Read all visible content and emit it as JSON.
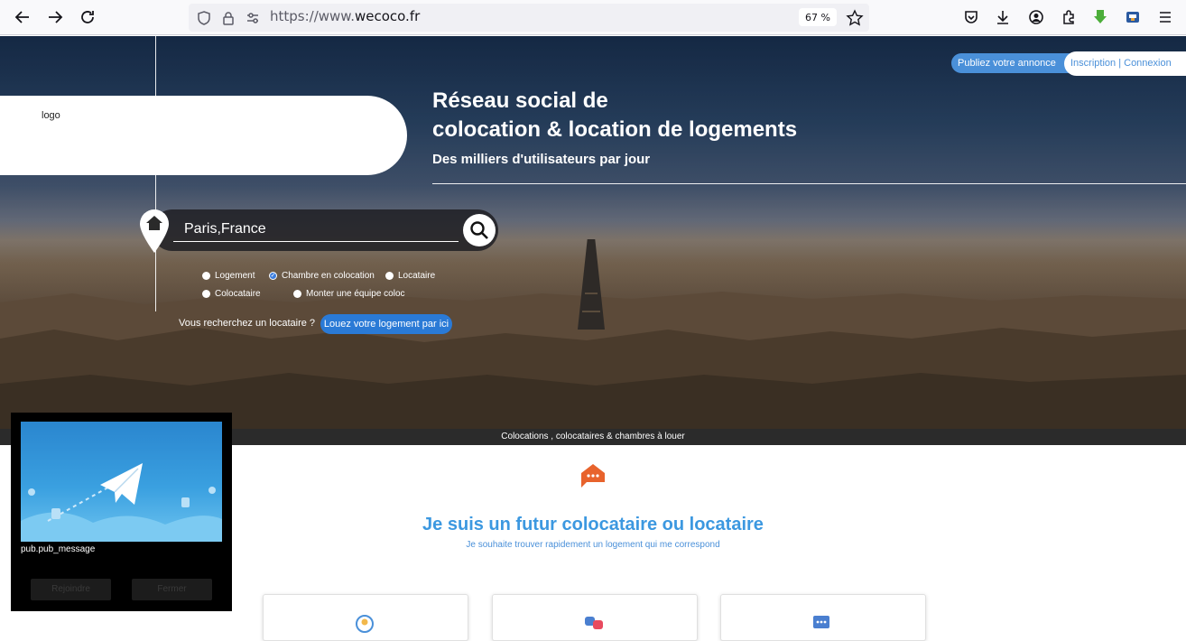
{
  "browser": {
    "url_prefix": "https://www.",
    "url_domain": "wecoco.fr",
    "zoom": "67 %"
  },
  "header": {
    "publish_label": "Publiez votre annonce",
    "signup_label": "Inscription",
    "separator": " | ",
    "login_label": "Connexion"
  },
  "logo": {
    "alt_text": "logo"
  },
  "hero": {
    "title_line1": "Réseau social de",
    "title_line2": "colocation & location de logements",
    "subtitle": "Des milliers d'utilisateurs par jour"
  },
  "search": {
    "value": "Paris,France"
  },
  "filters": [
    {
      "label": "Logement",
      "checked": false
    },
    {
      "label": "Chambre en colocation",
      "checked": true
    },
    {
      "label": "Locataire",
      "checked": false
    },
    {
      "label": "Colocataire",
      "checked": false
    },
    {
      "label": "Monter une équipe coloc",
      "checked": false
    }
  ],
  "landlord": {
    "question": "Vous recherchez un locataire ?",
    "button_label": "Louez votre logement par ici"
  },
  "strip": {
    "text": "Colocations , colocataires & chambres à louer"
  },
  "section": {
    "title": "Je suis un futur colocataire ou locataire",
    "subtitle": "Je souhaite trouver rapidement un logement qui me correspond"
  },
  "popup": {
    "message": "pub.pub_message",
    "join_label": "Rejoindre",
    "close_label": "Fermer"
  },
  "colors": {
    "accent": "#3c98e0",
    "button_blue": "#2a7ad6",
    "house_orange": "#e8632c"
  }
}
